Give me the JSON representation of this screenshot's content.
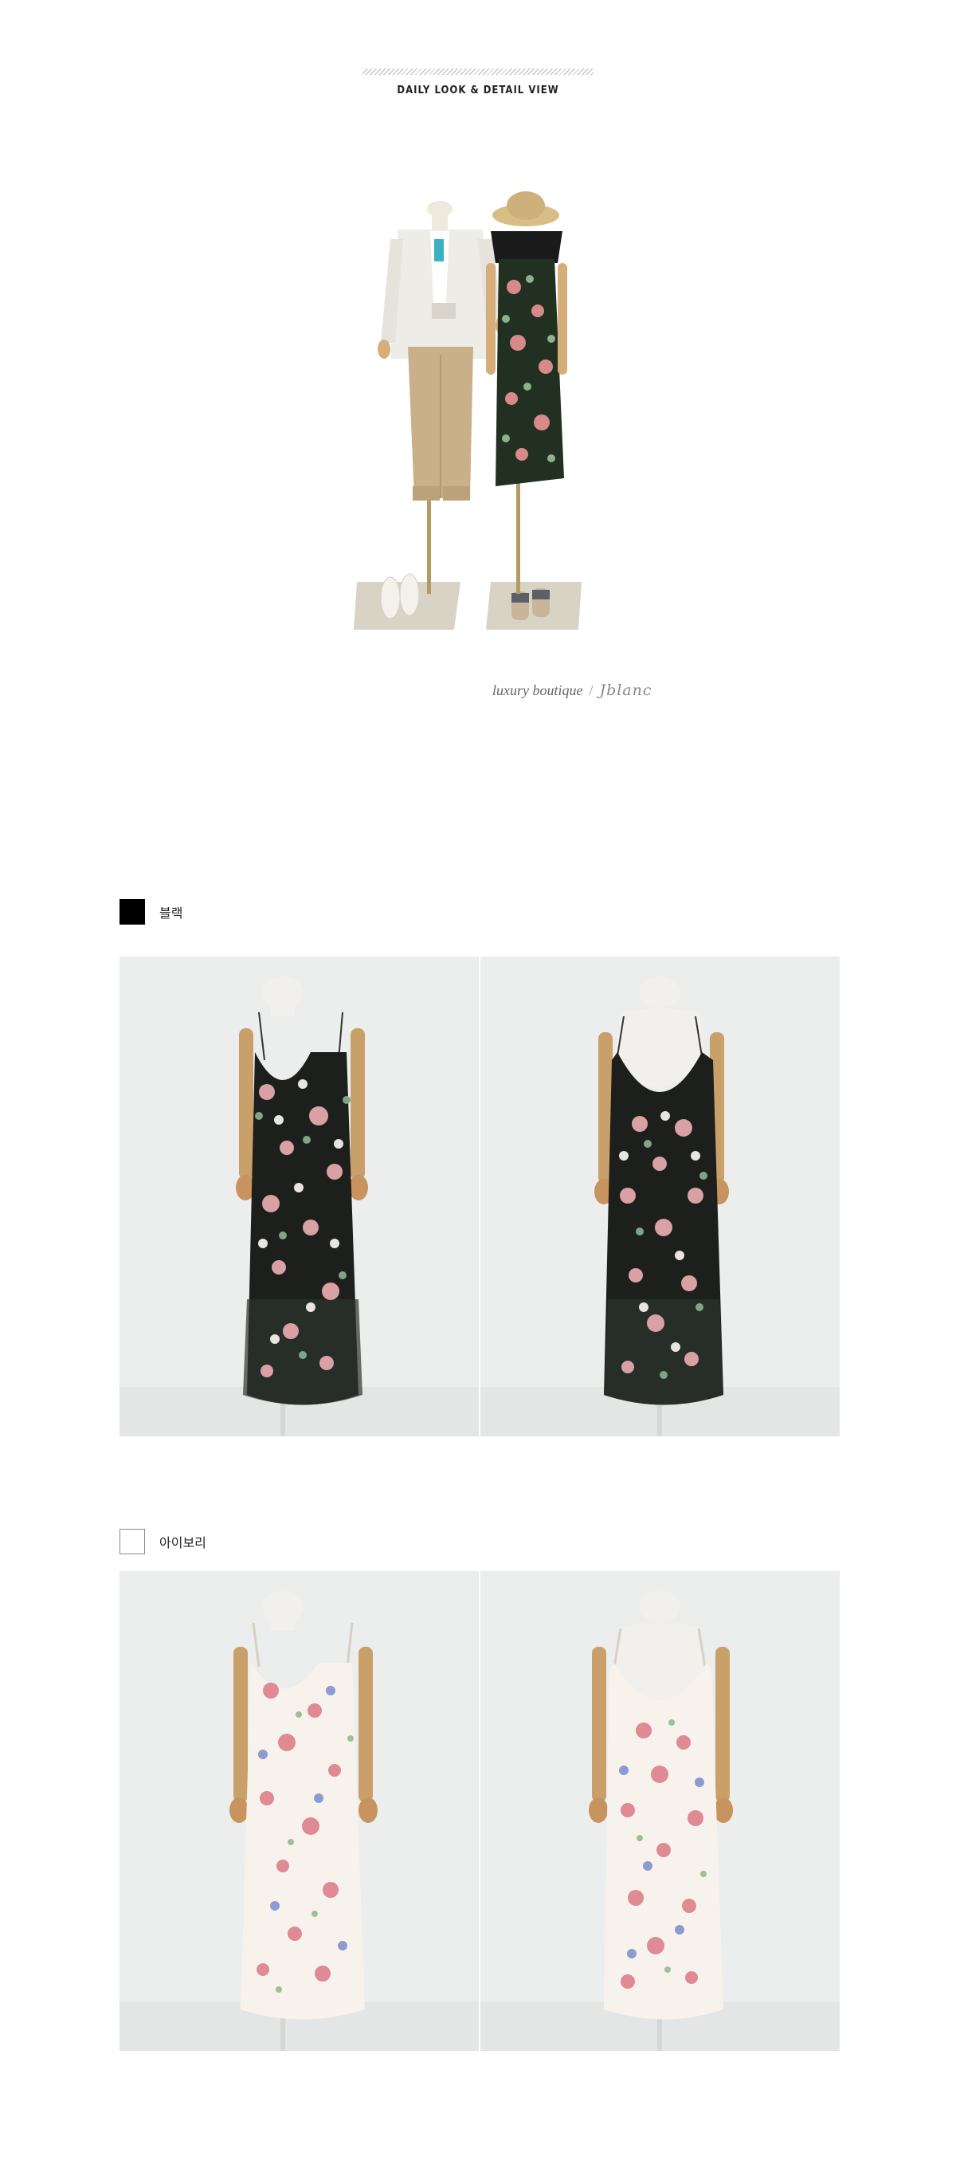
{
  "header": {
    "title": "DAILY LOOK & DETAIL VIEW"
  },
  "brand": {
    "tagline": "luxury boutique",
    "separator": "/",
    "logo": "Jblanc"
  },
  "colors": [
    {
      "name": "블랙",
      "swatch": "#000000"
    },
    {
      "name": "아이보리",
      "swatch": "#ffffff"
    }
  ],
  "icons": {
    "black_swatch": "black-swatch-icon",
    "ivory_swatch": "ivory-swatch-icon"
  },
  "palette": {
    "background": "#ffffff",
    "photo_background": "#eceded",
    "black_dress": "#1c1f1c",
    "ivory_dress": "#f7f3ec"
  }
}
